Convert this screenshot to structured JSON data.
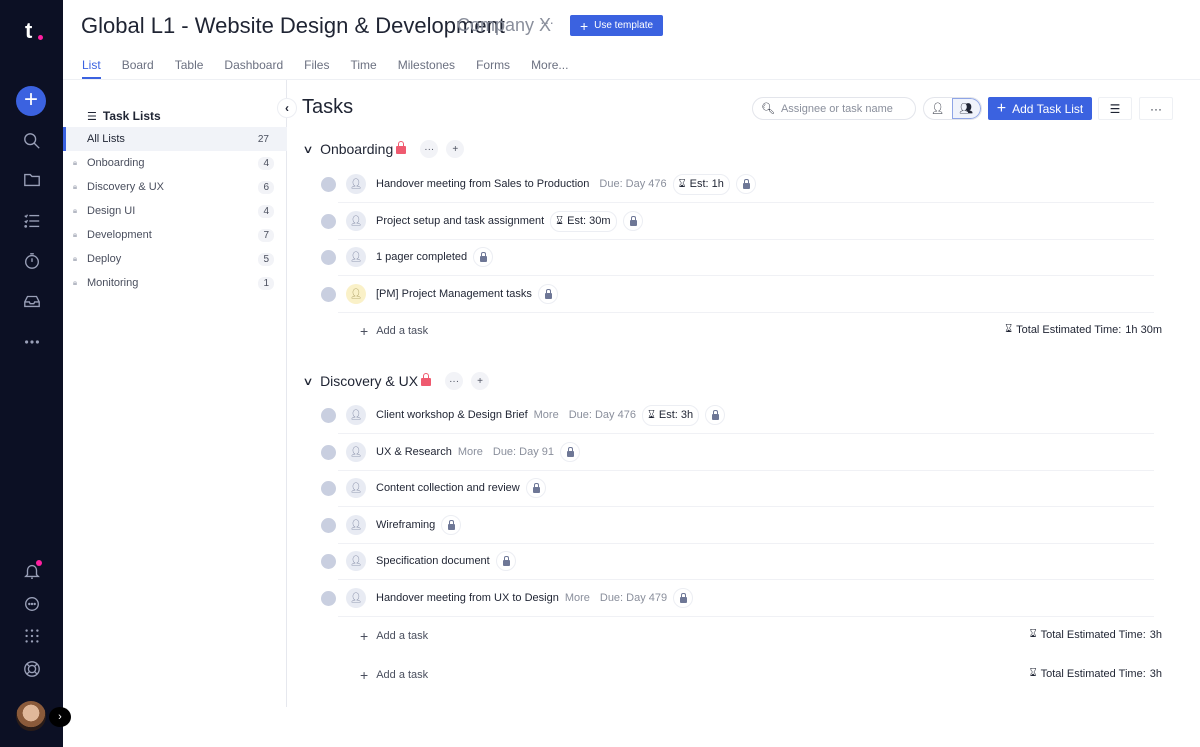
{
  "rail": {
    "logo": "t",
    "icons": [
      "add-icon",
      "search-icon",
      "folder-icon",
      "checklist-icon",
      "timer-icon",
      "inbox-icon",
      "more-icon",
      "bell-icon",
      "chat-icon",
      "apps-grid-icon",
      "help-lifebuoy-icon"
    ],
    "expand_glyph": "›"
  },
  "header": {
    "title": "Global L1 - Website Design & Development",
    "company": "Company X",
    "more_glyph": "···",
    "use_template_label": "Use template",
    "tabs": [
      {
        "label": "List",
        "active": true
      },
      {
        "label": "Board"
      },
      {
        "label": "Table"
      },
      {
        "label": "Dashboard"
      },
      {
        "label": "Files"
      },
      {
        "label": "Time"
      },
      {
        "label": "Milestones"
      },
      {
        "label": "Forms"
      },
      {
        "label": "More..."
      }
    ]
  },
  "task_lists": {
    "title": "Task Lists",
    "items": [
      {
        "label": "All Lists",
        "count": "27",
        "selected": true
      },
      {
        "label": "Onboarding",
        "count": "4"
      },
      {
        "label": "Discovery & UX",
        "count": "6"
      },
      {
        "label": "Design UI",
        "count": "4"
      },
      {
        "label": "Development",
        "count": "7"
      },
      {
        "label": "Deploy",
        "count": "5"
      },
      {
        "label": "Monitoring",
        "count": "1"
      }
    ]
  },
  "main": {
    "title": "Tasks",
    "search_placeholder": "Assignee or task name",
    "add_task_list_label": "Add Task List",
    "add_task_label": "Add a task",
    "total_label": "Total Estimated Time:",
    "groups": [
      {
        "name": "Onboarding",
        "total": "1h 30m",
        "tasks": [
          {
            "name": "Handover meeting from Sales to Production",
            "due": "Due: Day 476",
            "est": "Est: 1h"
          },
          {
            "name": "Project setup and task assignment",
            "est": "Est: 30m"
          },
          {
            "name": "1 pager completed"
          },
          {
            "name": "[PM] Project Management tasks",
            "assignee_highlight": true
          }
        ]
      },
      {
        "name": "Discovery & UX",
        "total": "3h",
        "tasks": [
          {
            "name": "Client workshop & Design Brief",
            "more": "More",
            "due": "Due: Day 476",
            "est": "Est: 3h"
          },
          {
            "name": "UX & Research",
            "more": "More",
            "due": "Due: Day 91"
          },
          {
            "name": "Content collection and review"
          },
          {
            "name": "Wireframing"
          },
          {
            "name": "Specification document"
          },
          {
            "name": "Handover meeting from UX to Design",
            "more": "More",
            "due": "Due: Day 479"
          }
        ]
      }
    ],
    "footer_total": "3h"
  }
}
